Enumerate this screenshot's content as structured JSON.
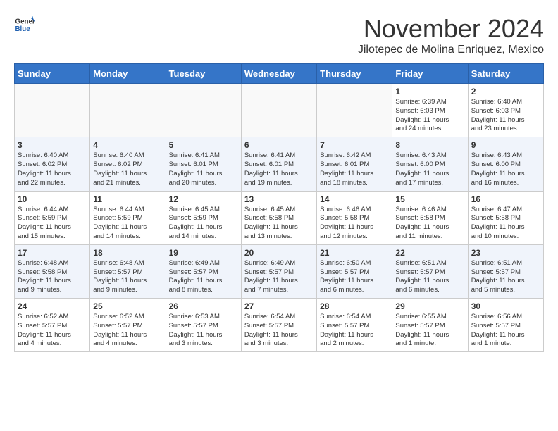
{
  "header": {
    "logo_general": "General",
    "logo_blue": "Blue",
    "month_title": "November 2024",
    "location": "Jilotepec de Molina Enriquez, Mexico"
  },
  "days_of_week": [
    "Sunday",
    "Monday",
    "Tuesday",
    "Wednesday",
    "Thursday",
    "Friday",
    "Saturday"
  ],
  "weeks": [
    {
      "days": [
        {
          "num": "",
          "info": ""
        },
        {
          "num": "",
          "info": ""
        },
        {
          "num": "",
          "info": ""
        },
        {
          "num": "",
          "info": ""
        },
        {
          "num": "",
          "info": ""
        },
        {
          "num": "1",
          "info": "Sunrise: 6:39 AM\nSunset: 6:03 PM\nDaylight: 11 hours\nand 24 minutes."
        },
        {
          "num": "2",
          "info": "Sunrise: 6:40 AM\nSunset: 6:03 PM\nDaylight: 11 hours\nand 23 minutes."
        }
      ]
    },
    {
      "days": [
        {
          "num": "3",
          "info": "Sunrise: 6:40 AM\nSunset: 6:02 PM\nDaylight: 11 hours\nand 22 minutes."
        },
        {
          "num": "4",
          "info": "Sunrise: 6:40 AM\nSunset: 6:02 PM\nDaylight: 11 hours\nand 21 minutes."
        },
        {
          "num": "5",
          "info": "Sunrise: 6:41 AM\nSunset: 6:01 PM\nDaylight: 11 hours\nand 20 minutes."
        },
        {
          "num": "6",
          "info": "Sunrise: 6:41 AM\nSunset: 6:01 PM\nDaylight: 11 hours\nand 19 minutes."
        },
        {
          "num": "7",
          "info": "Sunrise: 6:42 AM\nSunset: 6:01 PM\nDaylight: 11 hours\nand 18 minutes."
        },
        {
          "num": "8",
          "info": "Sunrise: 6:43 AM\nSunset: 6:00 PM\nDaylight: 11 hours\nand 17 minutes."
        },
        {
          "num": "9",
          "info": "Sunrise: 6:43 AM\nSunset: 6:00 PM\nDaylight: 11 hours\nand 16 minutes."
        }
      ]
    },
    {
      "days": [
        {
          "num": "10",
          "info": "Sunrise: 6:44 AM\nSunset: 5:59 PM\nDaylight: 11 hours\nand 15 minutes."
        },
        {
          "num": "11",
          "info": "Sunrise: 6:44 AM\nSunset: 5:59 PM\nDaylight: 11 hours\nand 14 minutes."
        },
        {
          "num": "12",
          "info": "Sunrise: 6:45 AM\nSunset: 5:59 PM\nDaylight: 11 hours\nand 14 minutes."
        },
        {
          "num": "13",
          "info": "Sunrise: 6:45 AM\nSunset: 5:58 PM\nDaylight: 11 hours\nand 13 minutes."
        },
        {
          "num": "14",
          "info": "Sunrise: 6:46 AM\nSunset: 5:58 PM\nDaylight: 11 hours\nand 12 minutes."
        },
        {
          "num": "15",
          "info": "Sunrise: 6:46 AM\nSunset: 5:58 PM\nDaylight: 11 hours\nand 11 minutes."
        },
        {
          "num": "16",
          "info": "Sunrise: 6:47 AM\nSunset: 5:58 PM\nDaylight: 11 hours\nand 10 minutes."
        }
      ]
    },
    {
      "days": [
        {
          "num": "17",
          "info": "Sunrise: 6:48 AM\nSunset: 5:58 PM\nDaylight: 11 hours\nand 9 minutes."
        },
        {
          "num": "18",
          "info": "Sunrise: 6:48 AM\nSunset: 5:57 PM\nDaylight: 11 hours\nand 9 minutes."
        },
        {
          "num": "19",
          "info": "Sunrise: 6:49 AM\nSunset: 5:57 PM\nDaylight: 11 hours\nand 8 minutes."
        },
        {
          "num": "20",
          "info": "Sunrise: 6:49 AM\nSunset: 5:57 PM\nDaylight: 11 hours\nand 7 minutes."
        },
        {
          "num": "21",
          "info": "Sunrise: 6:50 AM\nSunset: 5:57 PM\nDaylight: 11 hours\nand 6 minutes."
        },
        {
          "num": "22",
          "info": "Sunrise: 6:51 AM\nSunset: 5:57 PM\nDaylight: 11 hours\nand 6 minutes."
        },
        {
          "num": "23",
          "info": "Sunrise: 6:51 AM\nSunset: 5:57 PM\nDaylight: 11 hours\nand 5 minutes."
        }
      ]
    },
    {
      "days": [
        {
          "num": "24",
          "info": "Sunrise: 6:52 AM\nSunset: 5:57 PM\nDaylight: 11 hours\nand 4 minutes."
        },
        {
          "num": "25",
          "info": "Sunrise: 6:52 AM\nSunset: 5:57 PM\nDaylight: 11 hours\nand 4 minutes."
        },
        {
          "num": "26",
          "info": "Sunrise: 6:53 AM\nSunset: 5:57 PM\nDaylight: 11 hours\nand 3 minutes."
        },
        {
          "num": "27",
          "info": "Sunrise: 6:54 AM\nSunset: 5:57 PM\nDaylight: 11 hours\nand 3 minutes."
        },
        {
          "num": "28",
          "info": "Sunrise: 6:54 AM\nSunset: 5:57 PM\nDaylight: 11 hours\nand 2 minutes."
        },
        {
          "num": "29",
          "info": "Sunrise: 6:55 AM\nSunset: 5:57 PM\nDaylight: 11 hours\nand 1 minute."
        },
        {
          "num": "30",
          "info": "Sunrise: 6:56 AM\nSunset: 5:57 PM\nDaylight: 11 hours\nand 1 minute."
        }
      ]
    }
  ]
}
